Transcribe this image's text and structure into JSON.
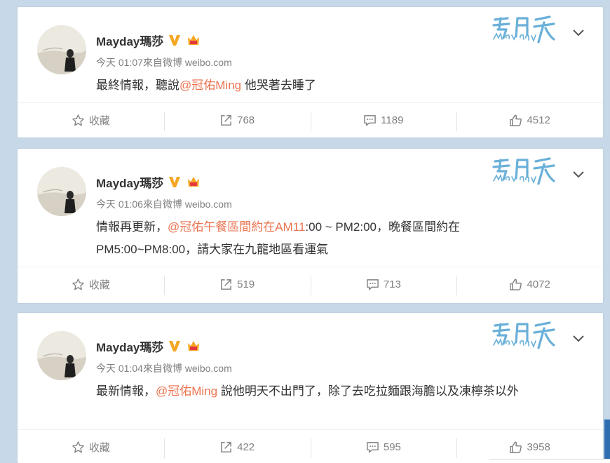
{
  "posts": [
    {
      "username": "Mayday瑪莎",
      "time": "今天 01:07",
      "source": "來自微博 weibo.com",
      "text_before": "最終情報，聽說",
      "mention": "@冠佑Ming",
      "text_after": " 他哭著去睡了",
      "actions": {
        "favorite": "收藏",
        "repost": "768",
        "comment": "1189",
        "like": "4512"
      }
    },
    {
      "username": "Mayday瑪莎",
      "time": "今天 01:06",
      "source": "來自微博 weibo.com",
      "text_before": "情報再更新，",
      "mention": "@冠佑午餐區間約在AM11",
      "text_after": ":00 ~ PM2:00，晚餐區間約在 PM5:00~PM8:00，請大家在九龍地區看運氣",
      "actions": {
        "favorite": "收藏",
        "repost": "519",
        "comment": "713",
        "like": "4072"
      }
    },
    {
      "username": "Mayday瑪莎",
      "time": "今天 01:04",
      "source": "來自微博 weibo.com",
      "text_before": "最新情報，",
      "mention": "@冠佑Ming",
      "text_after": " 說他明天不出門了，除了去吃拉麵跟海膽以及凍檸茶以外",
      "actions": {
        "favorite": "收藏",
        "repost": "422",
        "comment": "595",
        "like": "3958"
      }
    }
  ],
  "colors": {
    "accent_mention": "#eb7350",
    "verified": "#f6a623",
    "logo": "#6ab0d9",
    "background": "#c7d9e9"
  },
  "icons": {
    "favorite": "star-icon",
    "repost": "repost-icon",
    "comment": "comment-icon",
    "like": "thumbs-up-icon",
    "menu": "chevron-down-icon",
    "verified": "verified-v-icon",
    "vip": "vip-crown-icon"
  }
}
